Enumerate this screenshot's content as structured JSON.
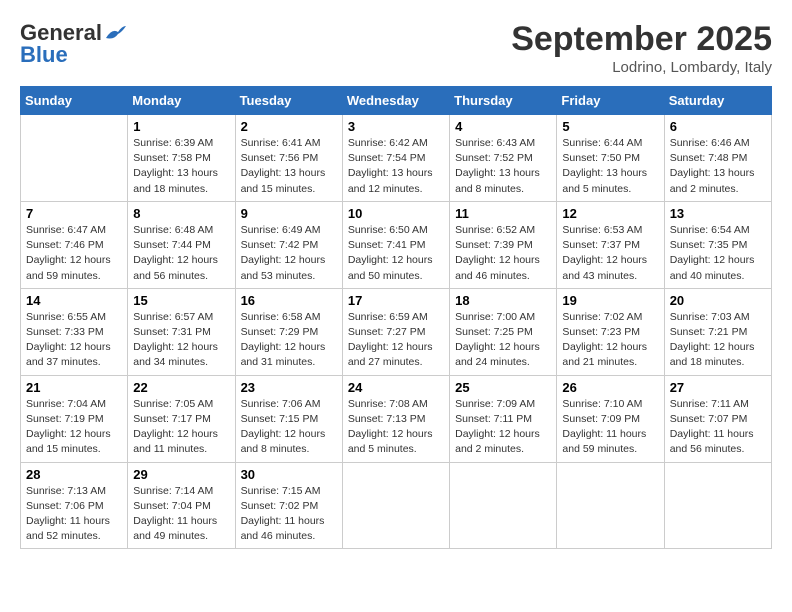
{
  "header": {
    "logo_line1": "General",
    "logo_line2": "Blue",
    "month_title": "September 2025",
    "location": "Lodrino, Lombardy, Italy"
  },
  "weekdays": [
    "Sunday",
    "Monday",
    "Tuesday",
    "Wednesday",
    "Thursday",
    "Friday",
    "Saturday"
  ],
  "weeks": [
    [
      {
        "day": "",
        "text": ""
      },
      {
        "day": "1",
        "text": "Sunrise: 6:39 AM\nSunset: 7:58 PM\nDaylight: 13 hours\nand 18 minutes."
      },
      {
        "day": "2",
        "text": "Sunrise: 6:41 AM\nSunset: 7:56 PM\nDaylight: 13 hours\nand 15 minutes."
      },
      {
        "day": "3",
        "text": "Sunrise: 6:42 AM\nSunset: 7:54 PM\nDaylight: 13 hours\nand 12 minutes."
      },
      {
        "day": "4",
        "text": "Sunrise: 6:43 AM\nSunset: 7:52 PM\nDaylight: 13 hours\nand 8 minutes."
      },
      {
        "day": "5",
        "text": "Sunrise: 6:44 AM\nSunset: 7:50 PM\nDaylight: 13 hours\nand 5 minutes."
      },
      {
        "day": "6",
        "text": "Sunrise: 6:46 AM\nSunset: 7:48 PM\nDaylight: 13 hours\nand 2 minutes."
      }
    ],
    [
      {
        "day": "7",
        "text": "Sunrise: 6:47 AM\nSunset: 7:46 PM\nDaylight: 12 hours\nand 59 minutes."
      },
      {
        "day": "8",
        "text": "Sunrise: 6:48 AM\nSunset: 7:44 PM\nDaylight: 12 hours\nand 56 minutes."
      },
      {
        "day": "9",
        "text": "Sunrise: 6:49 AM\nSunset: 7:42 PM\nDaylight: 12 hours\nand 53 minutes."
      },
      {
        "day": "10",
        "text": "Sunrise: 6:50 AM\nSunset: 7:41 PM\nDaylight: 12 hours\nand 50 minutes."
      },
      {
        "day": "11",
        "text": "Sunrise: 6:52 AM\nSunset: 7:39 PM\nDaylight: 12 hours\nand 46 minutes."
      },
      {
        "day": "12",
        "text": "Sunrise: 6:53 AM\nSunset: 7:37 PM\nDaylight: 12 hours\nand 43 minutes."
      },
      {
        "day": "13",
        "text": "Sunrise: 6:54 AM\nSunset: 7:35 PM\nDaylight: 12 hours\nand 40 minutes."
      }
    ],
    [
      {
        "day": "14",
        "text": "Sunrise: 6:55 AM\nSunset: 7:33 PM\nDaylight: 12 hours\nand 37 minutes."
      },
      {
        "day": "15",
        "text": "Sunrise: 6:57 AM\nSunset: 7:31 PM\nDaylight: 12 hours\nand 34 minutes."
      },
      {
        "day": "16",
        "text": "Sunrise: 6:58 AM\nSunset: 7:29 PM\nDaylight: 12 hours\nand 31 minutes."
      },
      {
        "day": "17",
        "text": "Sunrise: 6:59 AM\nSunset: 7:27 PM\nDaylight: 12 hours\nand 27 minutes."
      },
      {
        "day": "18",
        "text": "Sunrise: 7:00 AM\nSunset: 7:25 PM\nDaylight: 12 hours\nand 24 minutes."
      },
      {
        "day": "19",
        "text": "Sunrise: 7:02 AM\nSunset: 7:23 PM\nDaylight: 12 hours\nand 21 minutes."
      },
      {
        "day": "20",
        "text": "Sunrise: 7:03 AM\nSunset: 7:21 PM\nDaylight: 12 hours\nand 18 minutes."
      }
    ],
    [
      {
        "day": "21",
        "text": "Sunrise: 7:04 AM\nSunset: 7:19 PM\nDaylight: 12 hours\nand 15 minutes."
      },
      {
        "day": "22",
        "text": "Sunrise: 7:05 AM\nSunset: 7:17 PM\nDaylight: 12 hours\nand 11 minutes."
      },
      {
        "day": "23",
        "text": "Sunrise: 7:06 AM\nSunset: 7:15 PM\nDaylight: 12 hours\nand 8 minutes."
      },
      {
        "day": "24",
        "text": "Sunrise: 7:08 AM\nSunset: 7:13 PM\nDaylight: 12 hours\nand 5 minutes."
      },
      {
        "day": "25",
        "text": "Sunrise: 7:09 AM\nSunset: 7:11 PM\nDaylight: 12 hours\nand 2 minutes."
      },
      {
        "day": "26",
        "text": "Sunrise: 7:10 AM\nSunset: 7:09 PM\nDaylight: 11 hours\nand 59 minutes."
      },
      {
        "day": "27",
        "text": "Sunrise: 7:11 AM\nSunset: 7:07 PM\nDaylight: 11 hours\nand 56 minutes."
      }
    ],
    [
      {
        "day": "28",
        "text": "Sunrise: 7:13 AM\nSunset: 7:06 PM\nDaylight: 11 hours\nand 52 minutes."
      },
      {
        "day": "29",
        "text": "Sunrise: 7:14 AM\nSunset: 7:04 PM\nDaylight: 11 hours\nand 49 minutes."
      },
      {
        "day": "30",
        "text": "Sunrise: 7:15 AM\nSunset: 7:02 PM\nDaylight: 11 hours\nand 46 minutes."
      },
      {
        "day": "",
        "text": ""
      },
      {
        "day": "",
        "text": ""
      },
      {
        "day": "",
        "text": ""
      },
      {
        "day": "",
        "text": ""
      }
    ]
  ]
}
